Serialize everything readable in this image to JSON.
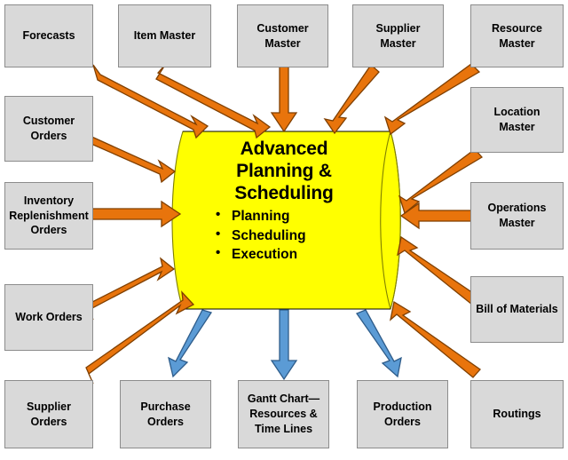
{
  "diagram": {
    "type": "hub-and-spoke-flow",
    "background_color": "#ffffff",
    "hub": {
      "shape": "cylinder",
      "fill_color": "#ffff00",
      "outline_color": "#7f7f00",
      "title": "Advanced\nPlanning &\nScheduling",
      "bullets": [
        "Planning",
        "Scheduling",
        "Execution"
      ]
    },
    "colors": {
      "input_arrow": "#e8740c",
      "input_arrow_outline": "#7f3f00",
      "output_arrow": "#5b9bd5",
      "output_arrow_outline": "#2e5c8a",
      "box_fill": "#d9d9d9",
      "box_border": "#8c8c8c"
    },
    "inputs": [
      {
        "id": "forecasts",
        "label": "Forecasts"
      },
      {
        "id": "item-master",
        "label": "Item Master"
      },
      {
        "id": "customer-master",
        "label": "Customer\nMaster"
      },
      {
        "id": "supplier-master",
        "label": "Supplier\nMaster"
      },
      {
        "id": "resource-master",
        "label": "Resource\nMaster"
      },
      {
        "id": "customer-orders",
        "label": "Customer\nOrders"
      },
      {
        "id": "location-master",
        "label": "Location\nMaster"
      },
      {
        "id": "inventory-replenishment-orders",
        "label": "Inventory\nReplenishment\nOrders"
      },
      {
        "id": "operations-master",
        "label": "Operations\nMaster"
      },
      {
        "id": "work-orders",
        "label": "Work Orders"
      },
      {
        "id": "bill-of-materials",
        "label": "Bill of Materials"
      },
      {
        "id": "supplier-orders",
        "label": "Supplier Orders"
      },
      {
        "id": "routings",
        "label": "Routings"
      }
    ],
    "outputs": [
      {
        "id": "purchase-orders",
        "label": "Purchase\nOrders"
      },
      {
        "id": "gantt-chart",
        "label": "Gantt Chart—\nResources &\nTime Lines"
      },
      {
        "id": "production-orders",
        "label": "Production\nOrders"
      }
    ]
  }
}
